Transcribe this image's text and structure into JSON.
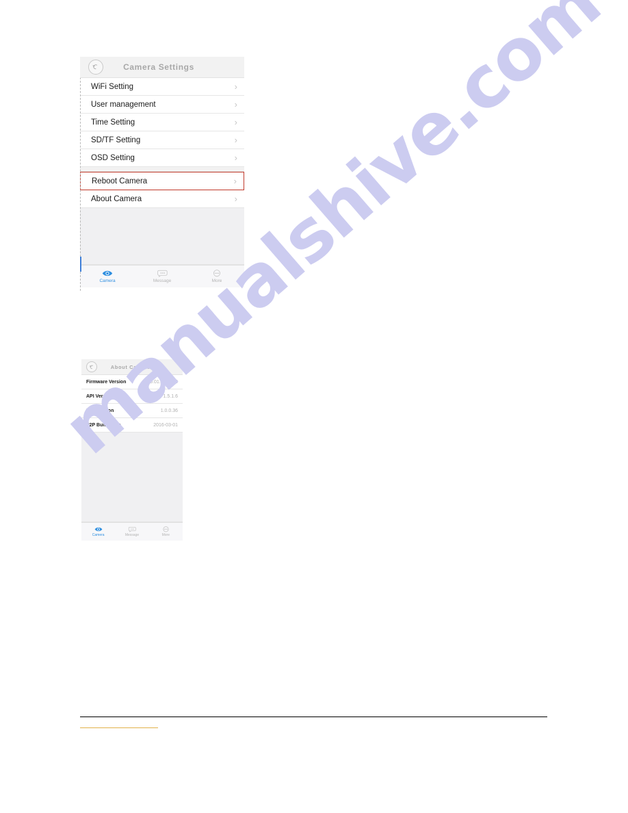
{
  "document": {
    "watermark_text": "manualshive.com",
    "watermark_color": "#ccccf0",
    "accent_rule_color": "#e2b24a",
    "rule_color": "#000000"
  },
  "screen_settings": {
    "name": "camera-settings-screen",
    "header": {
      "title": "Camera Settings",
      "back_icon": "back-arrow-icon"
    },
    "rows": [
      {
        "label": "WiFi Setting",
        "chevron": "chevron-right-icon",
        "highlighted": false
      },
      {
        "label": "User management",
        "chevron": "chevron-right-icon",
        "highlighted": false
      },
      {
        "label": "Time Setting",
        "chevron": "chevron-right-icon",
        "highlighted": false
      },
      {
        "label": "SD/TF Setting",
        "chevron": "chevron-right-icon",
        "highlighted": false
      },
      {
        "label": "OSD Setting",
        "chevron": "chevron-right-icon",
        "highlighted": false
      },
      {
        "label": "Reboot Camera",
        "chevron": "chevron-right-icon",
        "highlighted": true
      },
      {
        "label": "About Camera",
        "chevron": "chevron-right-icon",
        "highlighted": false
      }
    ],
    "highlight_color": "#c0392b",
    "tabs": [
      {
        "label": "Camera",
        "icon": "camera-eye-icon",
        "active": true
      },
      {
        "label": "Message",
        "icon": "message-bubble-icon",
        "active": false
      },
      {
        "label": "More",
        "icon": "more-dots-icon",
        "active": false
      }
    ],
    "active_tab_color": "#2f8fe0"
  },
  "screen_about": {
    "name": "about-camera-screen",
    "header": {
      "title": "About Camera",
      "back_icon": "back-arrow-icon"
    },
    "rows": [
      {
        "label": "Firmware Version",
        "value": "00.01.01.0040"
      },
      {
        "label": "API Version",
        "value": "1.5.1.6"
      },
      {
        "label": "P2P Version",
        "value": "1.0.0.36"
      },
      {
        "label": "P2P Bulid Time",
        "value": "2016-03-01"
      }
    ],
    "tabs": [
      {
        "label": "Camera",
        "icon": "camera-eye-icon",
        "active": true
      },
      {
        "label": "Message",
        "icon": "message-bubble-icon",
        "active": false
      },
      {
        "label": "More",
        "icon": "more-dots-icon",
        "active": false
      }
    ],
    "active_tab_color": "#2f8fe0"
  }
}
